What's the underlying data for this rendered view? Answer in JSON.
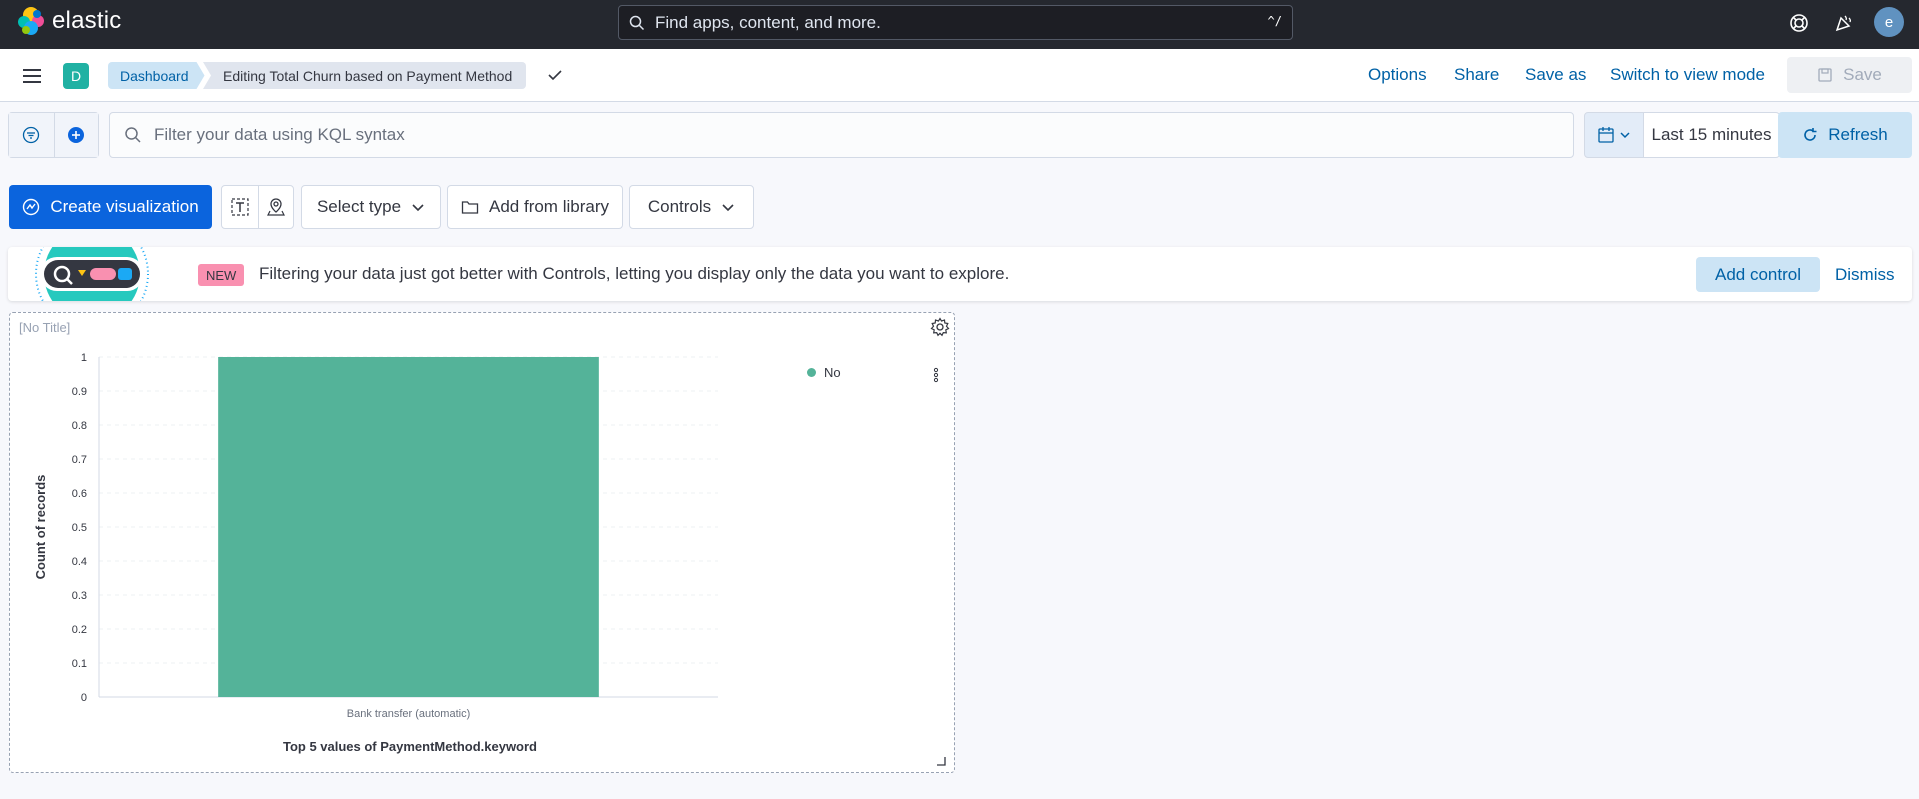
{
  "header": {
    "logo_text": "elastic",
    "search_placeholder": "Find apps, content, and more.",
    "search_shortcut": "^/",
    "avatar_initial": "e"
  },
  "nav": {
    "space_initial": "D",
    "breadcrumbs": [
      "Dashboard",
      "Editing Total Churn based on Payment Method"
    ],
    "options": "Options",
    "share": "Share",
    "save_as": "Save as",
    "switch_mode": "Switch to view mode",
    "save": "Save"
  },
  "query": {
    "placeholder": "Filter your data using KQL syntax",
    "time_range": "Last 15 minutes",
    "refresh": "Refresh"
  },
  "toolbar": {
    "create": "Create visualization",
    "select_type": "Select type",
    "add_from_library": "Add from library",
    "controls": "Controls"
  },
  "callout": {
    "badge": "NEW",
    "text": "Filtering your data just got better with Controls, letting you display only the data you want to explore.",
    "add_control": "Add control",
    "dismiss": "Dismiss"
  },
  "panel": {
    "title": "[No Title]"
  },
  "chart_data": {
    "type": "bar",
    "categories": [
      "Bank transfer (automatic)"
    ],
    "series": [
      {
        "name": "No",
        "values": [
          1
        ],
        "color": "#54b399"
      }
    ],
    "xlabel": "Top 5 values of PaymentMethod.keyword",
    "ylabel": "Count of records",
    "ylim": [
      0,
      1
    ],
    "yticks": [
      "0",
      "0.1",
      "0.2",
      "0.3",
      "0.4",
      "0.5",
      "0.6",
      "0.7",
      "0.8",
      "0.9",
      "1"
    ],
    "grid": true,
    "legend": "top-right"
  },
  "colors": {
    "header_bg": "#25282f",
    "accent": "#0b64dd",
    "link": "#0061a6",
    "bar": "#54b399"
  }
}
